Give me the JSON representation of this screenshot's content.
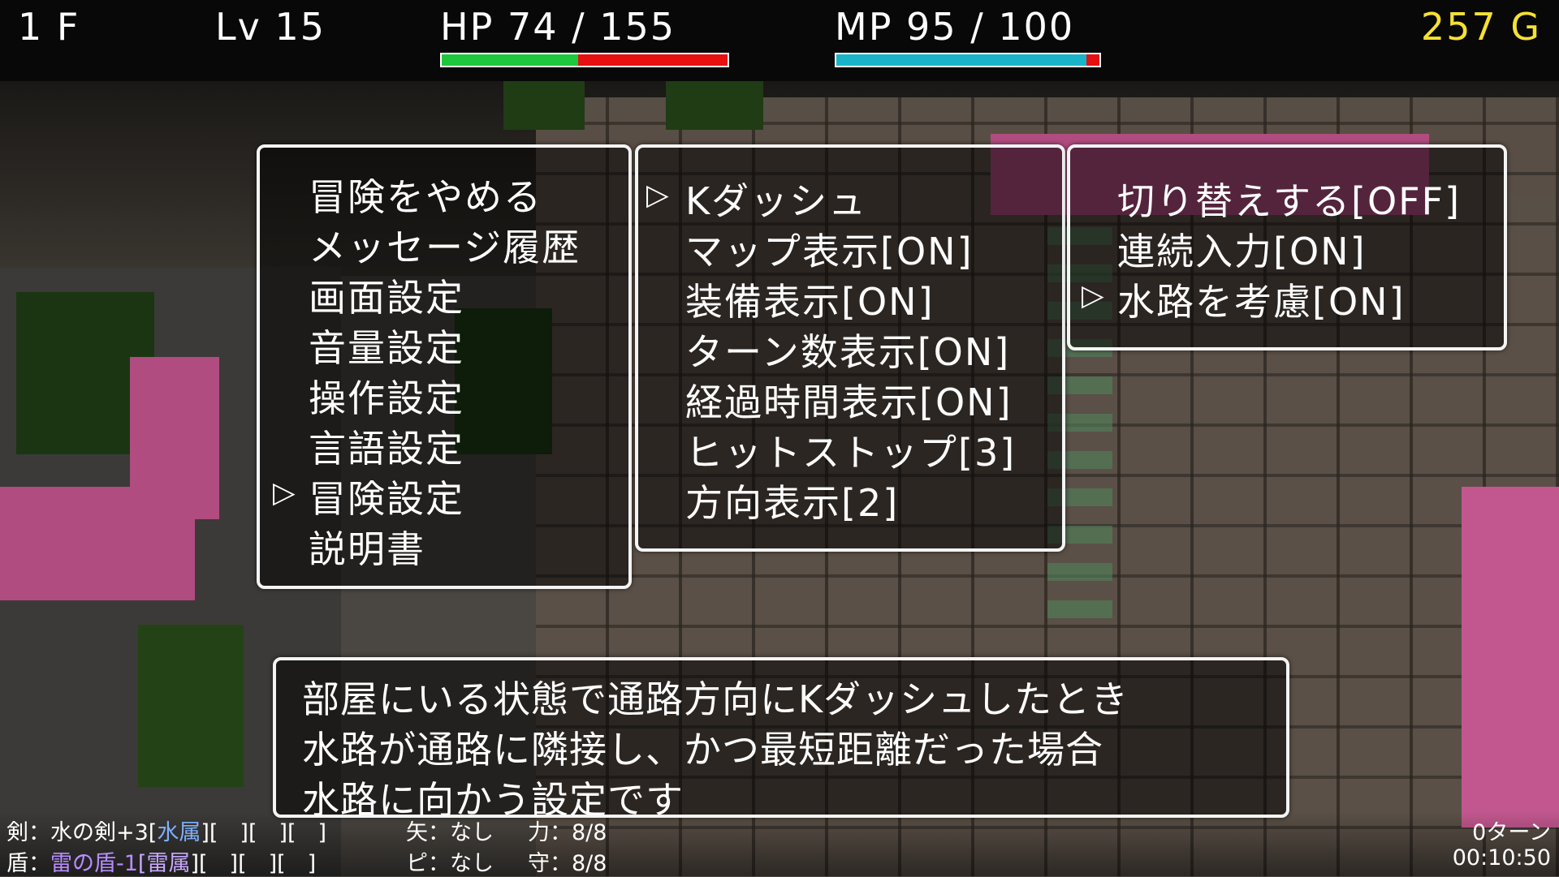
{
  "hud": {
    "floor": "1 F",
    "level": "Lv 15",
    "hp_text": "HP 74 / 155",
    "hp_fraction": 0.477,
    "mp_text": "MP 95 / 100",
    "mp_fraction": 0.95,
    "gold": "257 G",
    "colors": {
      "hp_fill": "#1ec83c",
      "hp_empty": "#e61010",
      "mp_fill": "#19b4c8",
      "gold": "#f5e132"
    }
  },
  "cursor_glyph": "▷",
  "menu_main": {
    "items": [
      "冒険をやめる",
      "メッセージ履歴",
      "画面設定",
      "音量設定",
      "操作設定",
      "言語設定",
      "冒険設定",
      "説明書"
    ],
    "selected_index": 6
  },
  "menu_adventure": {
    "items": [
      "Kダッシュ",
      "マップ表示[ON]",
      "装備表示[ON]",
      "ターン数表示[ON]",
      "経過時間表示[ON]",
      "ヒットストップ[3]",
      "方向表示[2]"
    ],
    "selected_index": 0
  },
  "menu_kdash": {
    "items": [
      "切り替えする[OFF]",
      "連続入力[ON]",
      "水路を考慮[ON]"
    ],
    "selected_index": 2
  },
  "description": {
    "lines": [
      "部屋にいる状態で通路方向にKダッシュしたとき",
      "水路が通路に隣接し、かつ最短距離だった場合",
      "水路に向かう設定です"
    ]
  },
  "equipment": {
    "weapon_label": "剣：水の剣+3[",
    "weapon_element": "水属",
    "weapon_slots": "][　][　][　]",
    "arrow": "矢：なし",
    "power": "力：8/8",
    "shield_label": "盾：",
    "shield_name": "雷の盾-1",
    "shield_element": "[雷属",
    "shield_slots": "][　][　][　]",
    "pot": "ピ：なし",
    "guard": "守：8/8"
  },
  "turns": "0ターン",
  "elapsed_time": "00:10:50"
}
